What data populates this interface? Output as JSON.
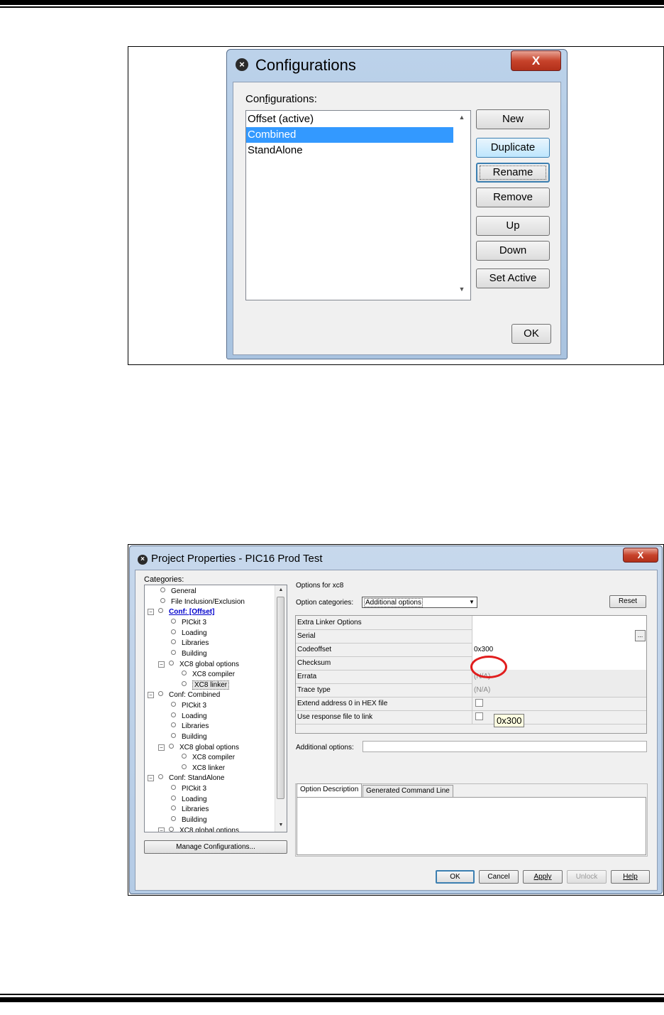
{
  "configurations_dialog": {
    "title": "Configurations",
    "close_label": "X",
    "list_label": "Configurations:",
    "items": [
      "Offset (active)",
      "Combined",
      "StandAlone"
    ],
    "selected_item": "Combined",
    "scroll_up": "▲",
    "scroll_down": "▼",
    "buttons": {
      "new": "New",
      "duplicate": "Duplicate",
      "rename": "Rename",
      "remove": "Remove",
      "up": "Up",
      "down": "Down",
      "set_active": "Set Active",
      "ok": "OK"
    }
  },
  "project_properties_dialog": {
    "title": "Project Properties - PIC16 Prod Test",
    "close_label": "X",
    "categories_label": "Categories:",
    "tree": [
      "General",
      "File Inclusion/Exclusion",
      "Conf: [Offset]",
      "PICkit 3",
      "Loading",
      "Libraries",
      "Building",
      "XC8 global options",
      "XC8 compiler",
      "XC8 linker",
      "Conf: Combined",
      "PICkit 3",
      "Loading",
      "Libraries",
      "Building",
      "XC8 global options",
      "XC8 compiler",
      "XC8 linker",
      "Conf: StandAlone",
      "PICkit 3",
      "Loading",
      "Libraries",
      "Building",
      "XC8 global options"
    ],
    "manage_configurations": "Manage Configurations...",
    "options_for": "Options for xc8",
    "option_categories_label": "Option categories:",
    "option_categories_value": "Additional options",
    "reset": "Reset",
    "options": [
      {
        "name": "Extra Linker Options",
        "value": ""
      },
      {
        "name": "Serial",
        "value": ""
      },
      {
        "name": "Codeoffset",
        "value": "0x300"
      },
      {
        "name": "Checksum",
        "value": ""
      },
      {
        "name": "Errata",
        "value": "(N/A)"
      },
      {
        "name": "Trace type",
        "value": "(N/A)"
      },
      {
        "name": "Extend address 0 in HEX file",
        "value": ""
      },
      {
        "name": "Use response file to link",
        "value": ""
      }
    ],
    "ellipsis": "...",
    "tooltip": "0x300",
    "additional_options_label": "Additional options:",
    "additional_options_value": "",
    "tabs": [
      "Option Description",
      "Generated Command Line"
    ],
    "buttons": {
      "ok": "OK",
      "cancel": "Cancel",
      "apply": "Apply",
      "unlock": "Unlock",
      "help": "Help"
    }
  }
}
